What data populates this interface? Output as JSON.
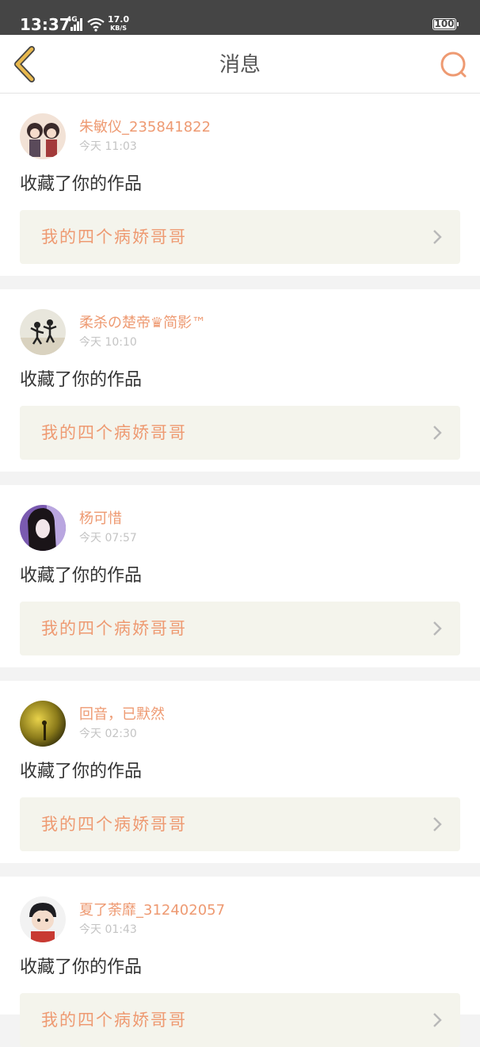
{
  "status_bar": {
    "time": "13:37",
    "network": "4G",
    "speed_value": "17.0",
    "speed_unit": "KB/S",
    "battery": "100"
  },
  "header": {
    "title": "消息",
    "back_icon": "chevron-left-icon",
    "search_icon": "search-icon"
  },
  "colors": {
    "accent": "#ee9a72",
    "back_icon": "#e8b84d",
    "link_bg": "#f4f4ec"
  },
  "messages": [
    {
      "username": "朱敏仪_235841822",
      "time": "今天 11:03",
      "action": "收藏了你的作品",
      "work_title": "我的四个病娇哥哥"
    },
    {
      "username": "柔杀の楚帝♛简影™",
      "time": "今天 10:10",
      "action": "收藏了你的作品",
      "work_title": "我的四个病娇哥哥"
    },
    {
      "username": "杨可惜",
      "time": "今天 07:57",
      "action": "收藏了你的作品",
      "work_title": "我的四个病娇哥哥"
    },
    {
      "username": "回音，已默然",
      "time": "今天 02:30",
      "action": "收藏了你的作品",
      "work_title": "我的四个病娇哥哥"
    },
    {
      "username": "夏了荼靡_312402057",
      "time": "今天 01:43",
      "action": "收藏了你的作品",
      "work_title": "我的四个病娇哥哥"
    }
  ]
}
